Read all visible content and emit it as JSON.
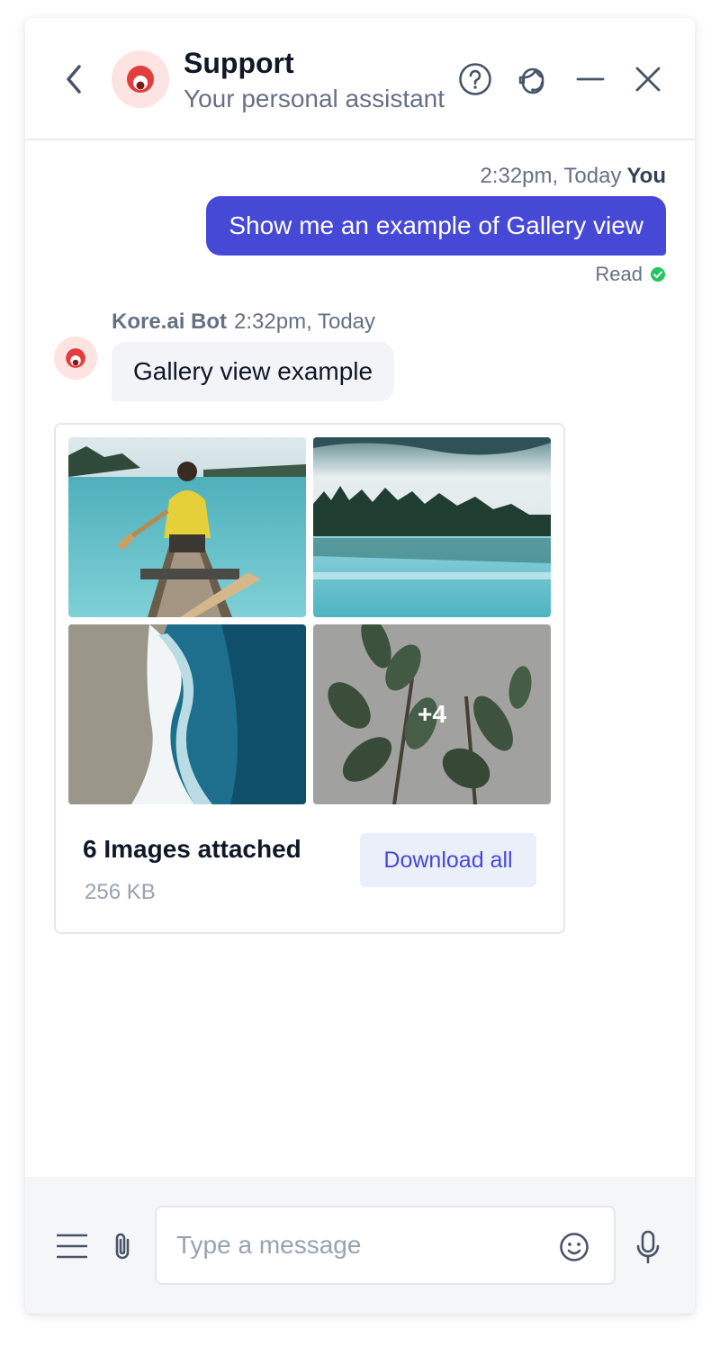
{
  "header": {
    "title": "Support",
    "subtitle": "Your personal assistant"
  },
  "messages": {
    "outgoing": {
      "time": "2:32pm, Today",
      "sender": "You",
      "text": "Show me an example of Gallery view",
      "status": "Read"
    },
    "incoming": {
      "sender": "Kore.ai Bot",
      "time": "2:32pm, Today",
      "text": "Gallery view example"
    }
  },
  "gallery": {
    "images": [
      "canoe-on-lake",
      "misty-forest-lake",
      "ocean-wave",
      "rubber-plant"
    ],
    "more_count": "+4",
    "title": "6 Images attached",
    "size": "256 KB",
    "download_label": "Download all"
  },
  "composer": {
    "placeholder": "Type a message"
  },
  "colors": {
    "accent": "#4648d6",
    "brand_red": "#e23d3d",
    "read_check": "#22c55e"
  }
}
